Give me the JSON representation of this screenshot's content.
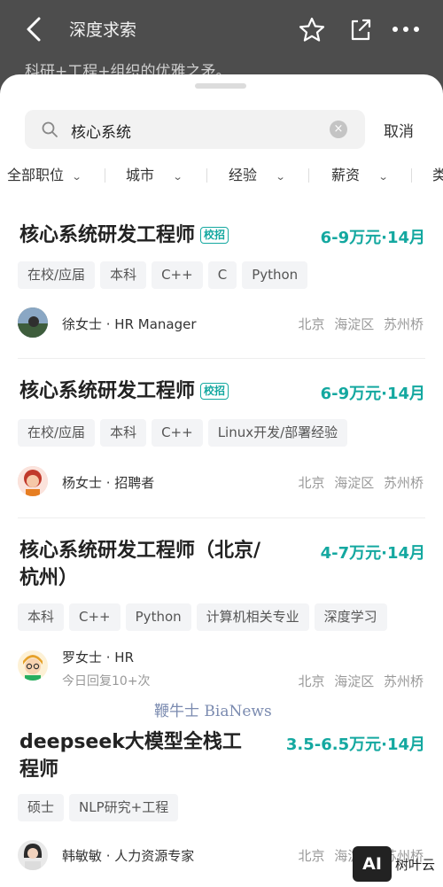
{
  "header": {
    "title": "深度求索",
    "peek_text": "科研+工程+组织的优雅之矛。"
  },
  "search": {
    "query": "核心系统",
    "clear_glyph": "×",
    "cancel_label": "取消"
  },
  "filters": [
    {
      "label": "全部职位"
    },
    {
      "label": "城市"
    },
    {
      "label": "经验"
    },
    {
      "label": "薪资"
    },
    {
      "label": "类"
    }
  ],
  "jobs": [
    {
      "title": "核心系统研发工程师",
      "badge": "校招",
      "salary": "6-9万元·14月",
      "tags": [
        "在校/应届",
        "本科",
        "C++",
        "C",
        "Python"
      ],
      "recruiter": "徐女士 · HR Manager",
      "reply": "",
      "location": "北京 海淀区 苏州桥"
    },
    {
      "title": "核心系统研发工程师",
      "badge": "校招",
      "salary": "6-9万元·14月",
      "tags": [
        "在校/应届",
        "本科",
        "C++",
        "Linux开发/部署经验"
      ],
      "recruiter": "杨女士 · 招聘者",
      "reply": "",
      "location": "北京 海淀区 苏州桥"
    },
    {
      "title": "核心系统研发工程师（北京/杭州）",
      "title_line1": "核心系统研发工程师（北京/",
      "title_line2": "杭州）",
      "badge": "",
      "salary": "4-7万元·14月",
      "tags": [
        "本科",
        "C++",
        "Python",
        "计算机相关专业",
        "深度学习"
      ],
      "recruiter": "罗女士 · HR",
      "reply": "今日回复10+次",
      "location": "北京 海淀区 苏州桥"
    },
    {
      "title": "deepseek大模型全栈工程师",
      "title_line1": "deepseek大模型全栈工",
      "title_line2": "程师",
      "badge": "",
      "salary": "3.5-6.5万元·14月",
      "tags": [
        "硕士",
        "NLP研究+工程"
      ],
      "recruiter": "韩敏敏 · 人力资源专家",
      "reply": "",
      "location": "北京 海淀区 苏州桥"
    }
  ],
  "watermarks": {
    "bianews": "鞭牛士 BiaNews",
    "ai_logo": "AI",
    "ai_text": "树叶云"
  },
  "colors": {
    "accent": "#14a8a0",
    "header_bg": "#4d4d4d"
  }
}
